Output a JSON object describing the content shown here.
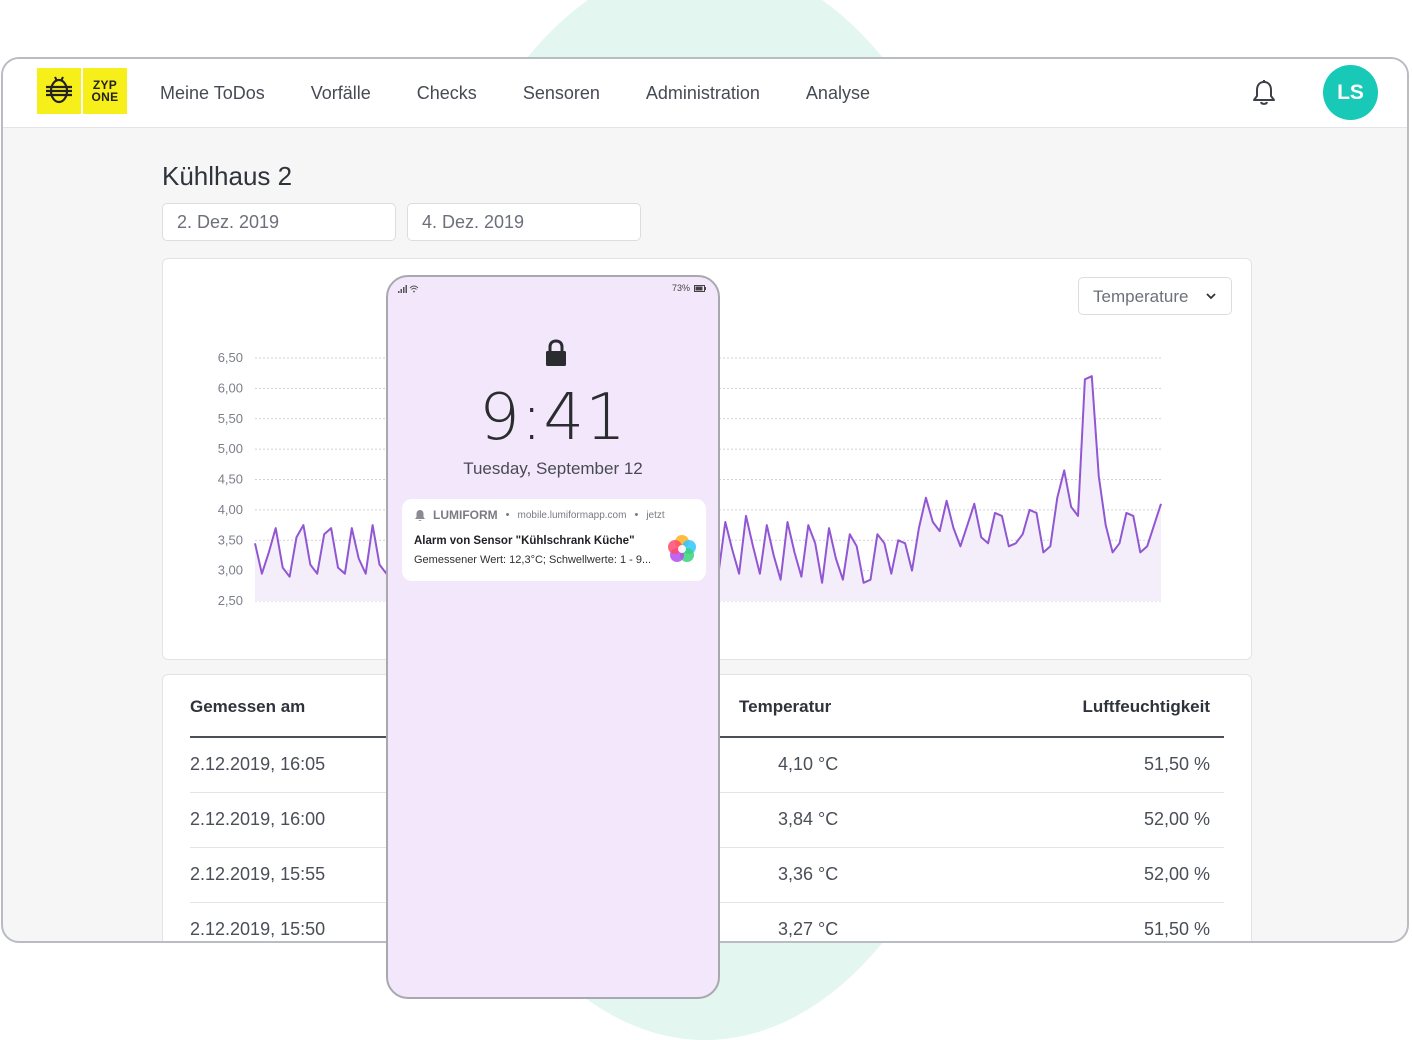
{
  "brand": {
    "logo_text_line1": "ZYP",
    "logo_text_line2": "ONE"
  },
  "nav": [
    "Meine ToDos",
    "Vorfälle",
    "Checks",
    "Sensoren",
    "Administration",
    "Analyse"
  ],
  "user": {
    "initials": "LS",
    "avatar_color": "#17c9b6"
  },
  "page": {
    "title": "Kühlhaus 2",
    "date_from": "2. Dez. 2019",
    "date_to": "4. Dez. 2019"
  },
  "chart_select": {
    "value": "Temperature"
  },
  "chart_data": {
    "type": "line",
    "series_color": "#9157d3",
    "yticks": [
      "6,50",
      "6,00",
      "5,50",
      "5,00",
      "4,50",
      "4,00",
      "3,50",
      "3,00",
      "2,50"
    ],
    "ylim": [
      2.5,
      6.5
    ],
    "grid": true,
    "y": [
      3.45,
      2.95,
      3.3,
      3.7,
      3.05,
      2.9,
      3.55,
      3.75,
      3.1,
      2.95,
      3.6,
      3.7,
      3.05,
      2.95,
      3.7,
      3.2,
      2.95,
      3.75,
      3.1,
      2.95,
      3.75,
      3.2,
      2.95,
      3.8,
      3.35,
      2.95,
      3.75,
      3.1,
      2.95,
      3.7,
      3.4,
      2.9,
      3.7,
      3.0,
      2.95,
      3.75,
      3.25,
      2.9,
      3.75,
      3.35,
      2.95,
      3.75,
      3.3,
      2.95,
      3.8,
      3.2,
      2.95,
      3.75,
      3.15,
      2.95,
      3.8,
      3.3,
      2.9,
      3.75,
      3.35,
      2.95,
      3.8,
      3.25,
      2.95,
      3.7,
      3.4,
      2.95,
      3.8,
      3.0,
      2.95,
      3.75,
      3.05,
      2.95,
      3.8,
      3.35,
      2.95,
      3.9,
      3.4,
      2.95,
      3.75,
      3.25,
      2.85,
      3.8,
      3.3,
      2.9,
      3.75,
      3.45,
      2.8,
      3.7,
      3.2,
      2.85,
      3.6,
      3.4,
      2.8,
      2.85,
      3.6,
      3.45,
      2.95,
      3.5,
      3.45,
      3.0,
      3.7,
      4.2,
      3.8,
      3.65,
      4.15,
      3.7,
      3.4,
      3.75,
      4.1,
      3.55,
      3.45,
      3.95,
      3.9,
      3.4,
      3.45,
      3.6,
      4.0,
      3.95,
      3.3,
      3.4,
      4.2,
      4.65,
      4.05,
      3.9,
      6.15,
      6.2,
      4.55,
      3.75,
      3.3,
      3.45,
      3.95,
      3.9,
      3.3,
      3.4,
      3.75,
      4.1
    ]
  },
  "table": {
    "headers": {
      "date": "Gemessen am",
      "temp": "Temperatur",
      "humidity": "Luftfeuchtigkeit"
    },
    "rows": [
      {
        "date": "2.12.2019, 16:05",
        "temp": "4,10 °C",
        "humidity": "51,50 %"
      },
      {
        "date": "2.12.2019, 16:00",
        "temp": "3,84 °C",
        "humidity": "52,00 %"
      },
      {
        "date": "2.12.2019, 15:55",
        "temp": "3,36 °C",
        "humidity": "52,00 %"
      },
      {
        "date": "2.12.2019, 15:50",
        "temp": "3,27 °C",
        "humidity": "51,50 %"
      }
    ]
  },
  "phone": {
    "battery": "73%",
    "time": "9:41",
    "date": "Tuesday, September 12",
    "notification": {
      "app": "LUMIFORM",
      "domain": "mobile.lumiformapp.com",
      "when": "jetzt",
      "title": "Alarm von Sensor \"Kühlschrank Küche\"",
      "body": "Gemessener Wert: 12,3°C; Schwellwerte: 1 - 9..."
    }
  }
}
